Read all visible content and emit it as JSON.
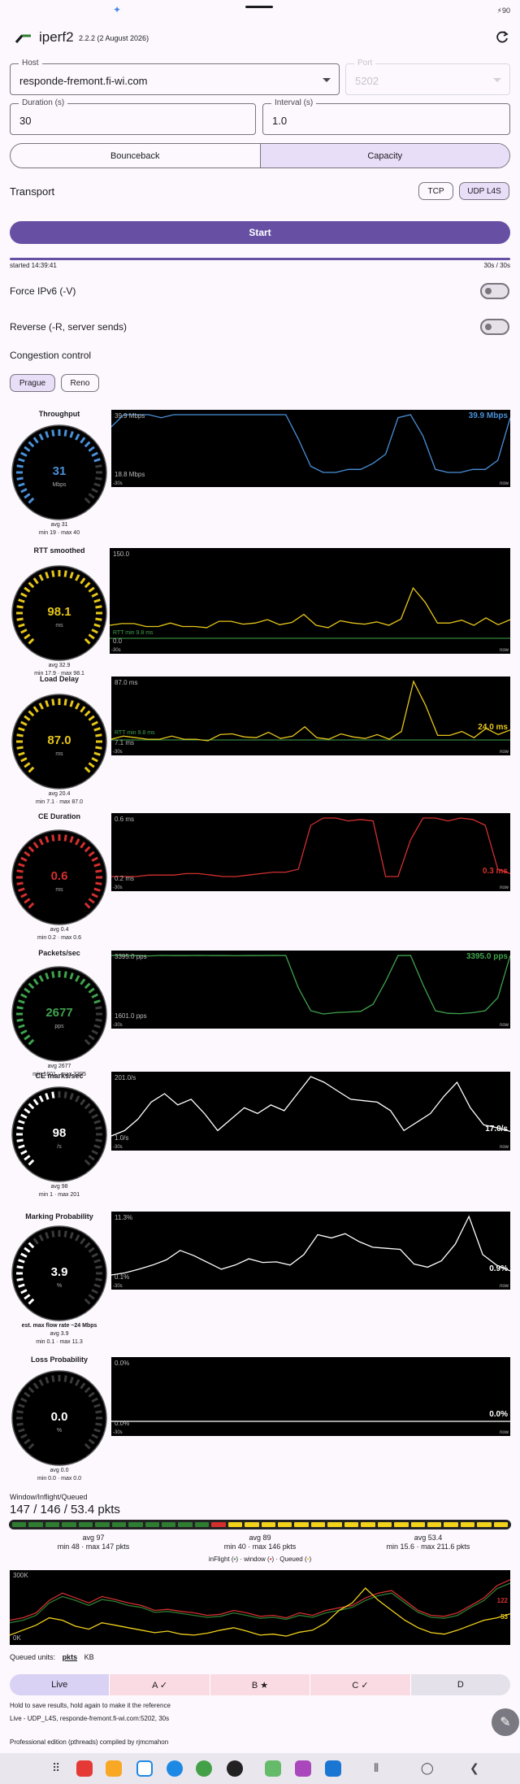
{
  "status": {
    "battery": "90"
  },
  "header": {
    "title": "iperf2",
    "version": "2.2.2 (2 August 2026)"
  },
  "form": {
    "host": {
      "label": "Host",
      "value": "responde-fremont.fi-wi.com"
    },
    "port": {
      "label": "Port",
      "value": "5202"
    },
    "duration": {
      "label": "Duration (s)",
      "value": "30"
    },
    "interval": {
      "label": "Interval (s)",
      "value": "1.0"
    }
  },
  "mode_tabs": [
    {
      "label": "Bounceback",
      "selected": false
    },
    {
      "label": "Capacity",
      "selected": true
    }
  ],
  "transport": {
    "label": "Transport",
    "options": [
      {
        "label": "TCP",
        "selected": false
      },
      {
        "label": "UDP L4S",
        "selected": true
      }
    ]
  },
  "start_label": "Start",
  "progress": {
    "started": "started 14:39:41",
    "elapsed": "30s / 30s",
    "fraction": 1.0
  },
  "toggles": {
    "ipv6": "Force IPv6 (-V)",
    "reverse": "Reverse (-R, server sends)"
  },
  "congestion": {
    "label": "Congestion control",
    "options": [
      {
        "label": "Prague",
        "selected": true
      },
      {
        "label": "Reno",
        "selected": false
      }
    ]
  },
  "window_label_30s": "-30s",
  "window_label_now": "now",
  "metrics": [
    {
      "title": "Throughput",
      "value": "31",
      "unit": "Mbps",
      "avg": "avg 31",
      "minmax": "min 19 · max 40",
      "extra": "",
      "color": "#4a90d9",
      "chart_top": "39.9 Mbps",
      "chart_bottom": "18.8 Mbps",
      "chart_last": "39.9 Mbps",
      "chart_floor": "",
      "series": [
        35,
        39,
        39,
        39,
        38,
        39,
        39,
        39,
        39,
        39,
        39,
        39,
        39,
        39,
        39,
        31,
        22,
        20,
        20,
        21,
        21,
        23,
        26,
        38,
        39,
        32,
        21,
        20,
        20,
        21,
        21,
        24,
        38
      ]
    },
    {
      "title": "RTT smoothed",
      "value": "98.1",
      "unit": "ms",
      "avg": "avg 32.9",
      "minmax": "min 17.9 · max 98.1",
      "extra": "",
      "color": "#e6c619",
      "chart_top": "150.0",
      "chart_bottom": "0.0",
      "chart_last": "",
      "chart_floor": "RTT min 9.8 ms",
      "series": [
        24,
        27,
        27,
        22,
        22,
        28,
        22,
        22,
        20,
        31,
        31,
        26,
        28,
        34,
        25,
        29,
        43,
        24,
        20,
        32,
        28,
        26,
        30,
        24,
        35,
        89,
        64,
        28,
        28,
        33,
        24,
        37,
        25,
        34
      ]
    },
    {
      "title": "Load Delay",
      "value": "87.0",
      "unit": "ms",
      "avg": "avg 20.4",
      "minmax": "min 7.1 · max 87.0",
      "extra": "",
      "color": "#e6c619",
      "chart_top": "87.0 ms",
      "chart_bottom": "7.1 ms",
      "chart_last": "24.0 ms",
      "chart_floor": "RTT min 9.8 ms",
      "series": [
        12,
        16,
        14,
        12,
        12,
        16,
        12,
        12,
        10,
        18,
        19,
        15,
        14,
        21,
        13,
        16,
        28,
        14,
        12,
        19,
        15,
        13,
        18,
        12,
        22,
        87,
        56,
        17,
        17,
        22,
        14,
        26,
        18,
        24
      ]
    },
    {
      "title": "CE Duration",
      "value": "0.6",
      "unit": "ms",
      "avg": "avg 0.4",
      "minmax": "min 0.2 · max 0.6",
      "extra": "",
      "color": "#d32f2f",
      "chart_top": "0.6 ms",
      "chart_bottom": "0.2 ms",
      "chart_last": "0.3 ms",
      "chart_floor": "",
      "series": [
        0.2,
        0.2,
        0.2,
        0.21,
        0.21,
        0.21,
        0.22,
        0.22,
        0.21,
        0.2,
        0.2,
        0.21,
        0.22,
        0.23,
        0.23,
        0.25,
        0.55,
        0.6,
        0.6,
        0.58,
        0.59,
        0.58,
        0.2,
        0.2,
        0.45,
        0.6,
        0.6,
        0.58,
        0.6,
        0.59,
        0.55,
        0.25,
        0.22
      ]
    },
    {
      "title": "Packets/sec",
      "value": "2677",
      "unit": "pps",
      "avg": "avg 2677",
      "minmax": "min 1601 · max 3395",
      "extra": "",
      "color": "#3fa34d",
      "chart_top": "3395.0 pps",
      "chart_bottom": "1601.0 pps",
      "chart_last": "3395.0 pps",
      "chart_floor": "",
      "series": [
        3395,
        3390,
        3390,
        3380,
        3395,
        3390,
        3390,
        3395,
        3390,
        3390,
        3385,
        3390,
        3390,
        3395,
        3390,
        2400,
        1700,
        1601,
        1640,
        1660,
        1680,
        1900,
        2600,
        3390,
        3395,
        2500,
        1700,
        1620,
        1610,
        1640,
        1700,
        2100,
        3395
      ]
    },
    {
      "title": "CE marks/sec",
      "value": "98",
      "unit": "/s",
      "avg": "avg 98",
      "minmax": "min 1 · max 201",
      "extra": "",
      "color": "#ffffff",
      "chart_top": "201.0/s",
      "chart_bottom": "1.0/s",
      "chart_last": "17.0/s",
      "chart_floor": "",
      "series": [
        1,
        20,
        60,
        120,
        150,
        110,
        130,
        80,
        20,
        60,
        100,
        80,
        110,
        90,
        150,
        210,
        190,
        160,
        130,
        125,
        120,
        90,
        20,
        50,
        80,
        140,
        190,
        100,
        40,
        30,
        17
      ]
    },
    {
      "title": "Marking Probability",
      "value": "3.9",
      "unit": "%",
      "avg": "avg 3.9",
      "minmax": "min 0.1 · max 11.3",
      "extra": "est. max flow rate ~24 Mbps",
      "color": "#ffffff",
      "chart_top": "11.3%",
      "chart_bottom": "0.1%",
      "chart_last": "0.9%",
      "chart_floor": "",
      "series": [
        0.1,
        0.5,
        1.2,
        2,
        3,
        4.8,
        3.8,
        2.5,
        1.2,
        2,
        3.2,
        2.5,
        2.6,
        2,
        4,
        7.8,
        7.2,
        8,
        6.5,
        5.4,
        5.2,
        5,
        2.2,
        1.6,
        2.8,
        6,
        11.3,
        4,
        2,
        0.9
      ]
    },
    {
      "title": "Loss Probability",
      "value": "0.0",
      "unit": "%",
      "avg": "avg 0.0",
      "minmax": "min 0.0 · max 0.0",
      "extra": "",
      "color": "#ffffff",
      "chart_top": "0.0%",
      "chart_bottom": "0.0%",
      "chart_last": "0.0%",
      "chart_floor": "",
      "series": [
        0,
        0,
        0,
        0,
        0,
        0,
        0,
        0,
        0,
        0,
        0,
        0,
        0,
        0,
        0,
        0,
        0,
        0,
        0,
        0,
        0,
        0,
        0,
        0,
        0,
        0,
        0,
        0,
        0,
        0
      ]
    }
  ],
  "window_queue": {
    "title": "Window/Inflight/Queued",
    "value": "147 / 146 / 53.4 pkts",
    "green_cells": 12,
    "red_cells": 1,
    "yellow_cells": 17,
    "stats": [
      {
        "avg": "avg 97",
        "minmax": "min 48 · max 147 pkts"
      },
      {
        "avg": "avg 89",
        "minmax": "min 40 · max 146 pkts"
      },
      {
        "avg": "avg 53.4",
        "minmax": "min 15.6 · max 211.6 pkts"
      }
    ],
    "legend": {
      "inflight": "inFlight (",
      "inflight_mark": "•",
      "window": ") · window (",
      "window_mark": "•",
      "queued": ") · Queued (",
      "queued_mark": "•",
      "end": ")"
    },
    "chart": {
      "top": "300K",
      "bottom": "0K",
      "last_red": "122",
      "last_yellow": "53",
      "window": [
        40,
        45,
        55,
        80,
        95,
        85,
        75,
        88,
        82,
        75,
        70,
        60,
        62,
        58,
        55,
        50,
        52,
        60,
        55,
        48,
        50,
        45,
        55,
        50,
        60,
        65,
        70,
        85,
        95,
        100,
        80,
        60,
        50,
        48,
        55,
        70,
        85,
        110,
        122
      ],
      "inflight": [
        35,
        40,
        50,
        75,
        88,
        80,
        70,
        82,
        78,
        70,
        66,
        56,
        58,
        54,
        50,
        46,
        48,
        55,
        50,
        44,
        46,
        42,
        50,
        46,
        55,
        60,
        66,
        80,
        90,
        95,
        75,
        56,
        46,
        44,
        50,
        66,
        80,
        104,
        115
      ],
      "queued": [
        10,
        20,
        30,
        45,
        40,
        28,
        22,
        35,
        30,
        25,
        20,
        15,
        18,
        12,
        10,
        14,
        20,
        25,
        18,
        10,
        12,
        8,
        16,
        20,
        35,
        60,
        75,
        105,
        80,
        60,
        40,
        25,
        15,
        12,
        20,
        30,
        40,
        45,
        53
      ]
    }
  },
  "queued_units": {
    "label": "Queued units:",
    "options": [
      "pkts",
      "KB"
    ],
    "selected": "pkts"
  },
  "result_tabs": [
    {
      "label": "Live",
      "bg": "#d9d2f5"
    },
    {
      "label": "A ✓",
      "bg": "#fbdbe3"
    },
    {
      "label": "B ★",
      "bg": "#fbdbe3"
    },
    {
      "label": "C ✓",
      "bg": "#fbdbe3"
    },
    {
      "label": "D",
      "bg": "#e5e1ea"
    }
  ],
  "hint": "Hold to save results, hold again to make it the reference",
  "live_desc": "Live - UDP_L4S, responde-fremont.fi-wi.com:5202, 30s",
  "edition": "Professional edition (pthreads) compiled by rjmcmahon"
}
